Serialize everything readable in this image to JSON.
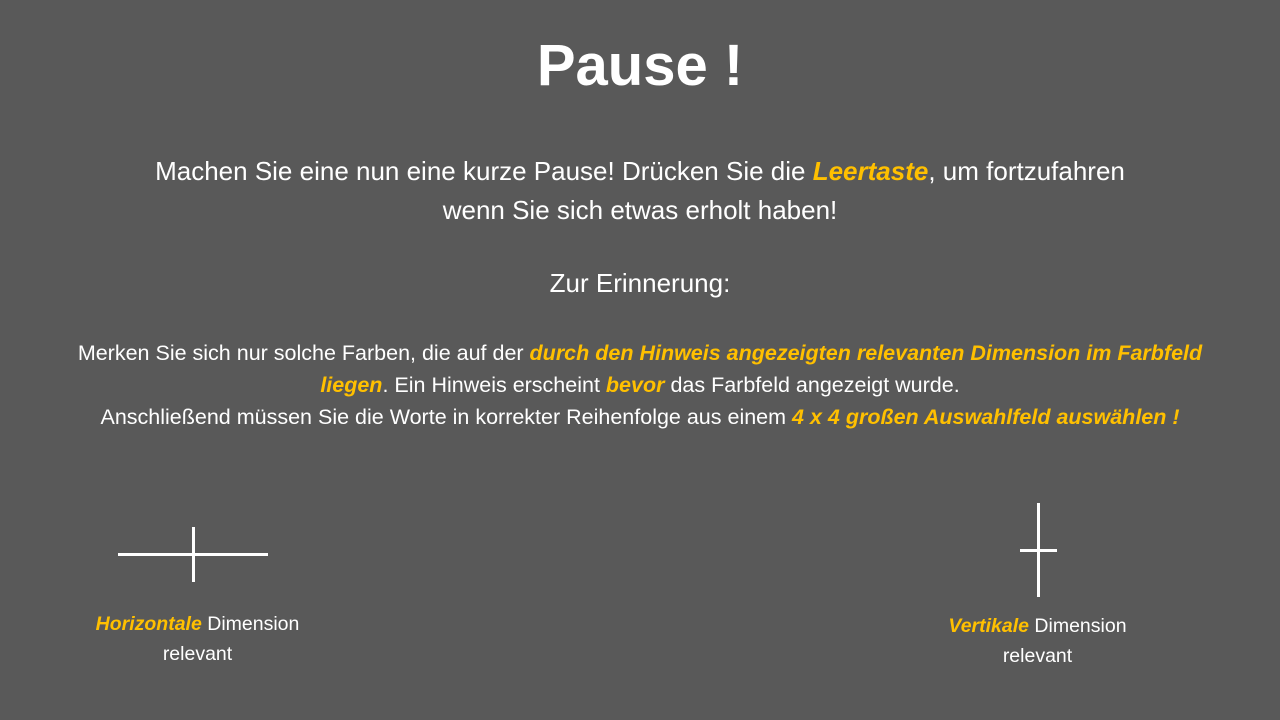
{
  "title": "Pause !",
  "intro": {
    "part1": "Machen Sie eine nun eine kurze Pause! Drücken Sie die ",
    "highlight": "Leertaste",
    "part2": ", um fortzufahren wenn Sie sich etwas erholt haben!"
  },
  "reminder": "Zur Erinnerung:",
  "paragraph": {
    "t1": "Merken Sie sich nur solche Farben, die auf der ",
    "h1": "durch den Hinweis angezeigten relevanten Dimension im Farbfeld liegen",
    "t2": ". Ein Hinweis erscheint ",
    "h2": "bevor",
    "t3": " das Farbfeld angezeigt wurde.",
    "t4": "Anschließend müssen Sie die Worte in korrekter Reihenfolge aus einem ",
    "h3": "4 x 4 großen Auswahlfeld auswählen !"
  },
  "horizontal": {
    "highlight": "Horizontale",
    "text": " Dimension relevant"
  },
  "vertical": {
    "highlight": "Vertikale",
    "text": " Dimension relevant"
  },
  "colors": {
    "background": "#595959",
    "accent": "#FFC000"
  }
}
